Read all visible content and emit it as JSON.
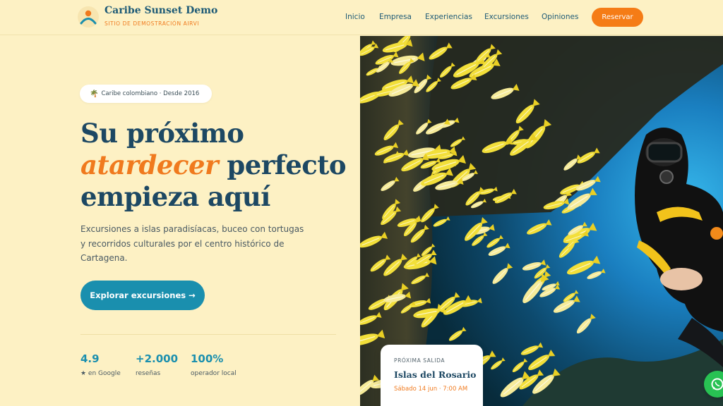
{
  "brand": {
    "title": "Caribe Sunset Demo",
    "subtitle": "SITIO DE DEMOSTRACIÓN AIRVI"
  },
  "nav": {
    "items": [
      "Inicio",
      "Empresa",
      "Experiencias",
      "Excursiones",
      "Opiniones"
    ],
    "cta": "Reservar"
  },
  "hero": {
    "badge": "Caribe colombiano · Desde 2016",
    "title_line1": "Su próximo",
    "title_accent": "atardecer",
    "title_line2_rest": "perfecto",
    "title_line3": "empieza aquí",
    "description": "Excursiones a islas paradisíacas, buceo con tortugas y recorridos culturales por el centro histórico de Cartagena.",
    "button": "Explorar excursiones →"
  },
  "stats": [
    {
      "value": "4.9",
      "label": "★ en Google"
    },
    {
      "value": "+2.000",
      "label": "reseñas"
    },
    {
      "value": "100%",
      "label": "operador local"
    }
  ],
  "next_departure": {
    "label": "PRÓXIMA SALIDA",
    "title": "Islas del Rosario",
    "time": "Sábado 14 jun · 7:00 AM"
  },
  "colors": {
    "background": "#fdf1c4",
    "accent_orange": "#f57c16",
    "accent_teal": "#1a8fae",
    "navy": "#1d4863",
    "whatsapp": "#28c253"
  }
}
